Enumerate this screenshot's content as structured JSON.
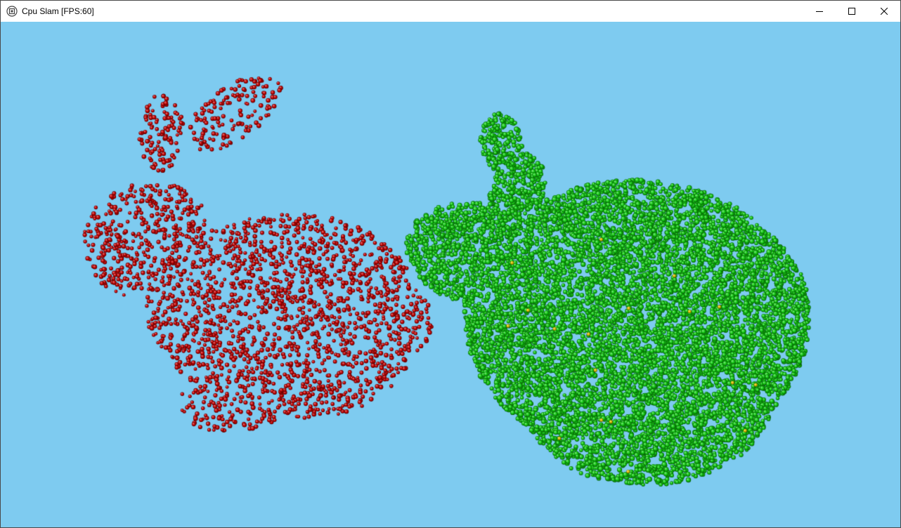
{
  "window": {
    "title": "Cpu Slam [FPS:60]",
    "app_icon": "app-window-icon",
    "controls": [
      "minimize-icon",
      "maximize-icon",
      "close-icon"
    ]
  },
  "scene": {
    "background_color": "#7ecbf0",
    "point_clouds": [
      {
        "role": "source",
        "color": "#c00000",
        "shape": "bunny"
      },
      {
        "role": "target",
        "color": "#10c810",
        "shape": "bunny-rotated"
      },
      {
        "role": "highlight",
        "color": "#e0c000"
      }
    ]
  }
}
